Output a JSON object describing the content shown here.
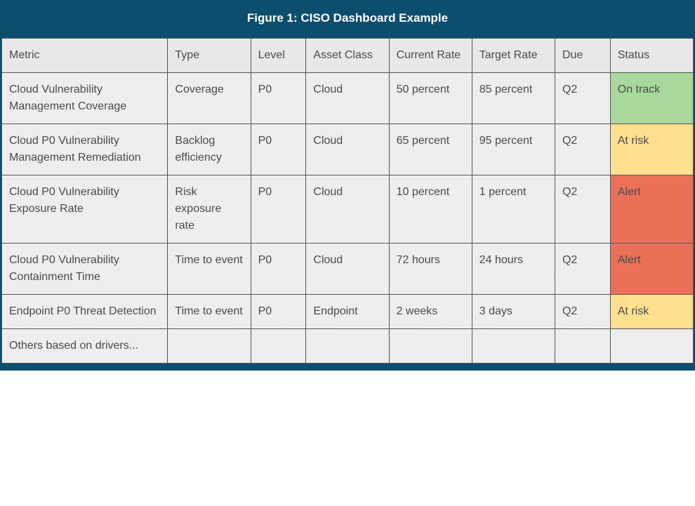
{
  "title": "Figure 1: CISO Dashboard Example",
  "columns": {
    "metric": "Metric",
    "type": "Type",
    "level": "Level",
    "asset": "Asset Class",
    "current": "Current Rate",
    "target": "Target Rate",
    "due": "Due",
    "status": "Status"
  },
  "status_colors": {
    "On track": "#a8d89b",
    "At risk": "#ffe08f",
    "Alert": "#ea7158"
  },
  "rows": [
    {
      "metric": "Cloud Vulnerability Management Coverage",
      "type": "Coverage",
      "level": "P0",
      "asset": "Cloud",
      "current": "50 percent",
      "target": "85 percent",
      "due": "Q2",
      "status": "On track",
      "status_class": "status-on-track"
    },
    {
      "metric": "Cloud P0 Vulnerability Management Remediation",
      "type": "Backlog efficiency",
      "level": "P0",
      "asset": "Cloud",
      "current": "65 percent",
      "target": "95 percent",
      "due": "Q2",
      "status": "At risk",
      "status_class": "status-at-risk"
    },
    {
      "metric": "Cloud P0 Vulnerability Exposure Rate",
      "type": "Risk exposure rate",
      "level": "P0",
      "asset": "Cloud",
      "current": "10 percent",
      "target": "1 percent",
      "due": "Q2",
      "status": "Alert",
      "status_class": "status-alert"
    },
    {
      "metric": "Cloud P0 Vulnerability Containment Time",
      "type": "Time to event",
      "level": "P0",
      "asset": "Cloud",
      "current": "72 hours",
      "target": "24 hours",
      "due": "Q2",
      "status": "Alert",
      "status_class": "status-alert"
    },
    {
      "metric": "Endpoint P0 Threat Detection",
      "type": "Time to event",
      "level": "P0",
      "asset": "Endpoint",
      "current": "2 weeks",
      "target": "3 days",
      "due": "Q2",
      "status": "At risk",
      "status_class": "status-at-risk"
    },
    {
      "metric": "Others based on drivers...",
      "type": "",
      "level": "",
      "asset": "",
      "current": "",
      "target": "",
      "due": "",
      "status": "",
      "status_class": ""
    }
  ]
}
